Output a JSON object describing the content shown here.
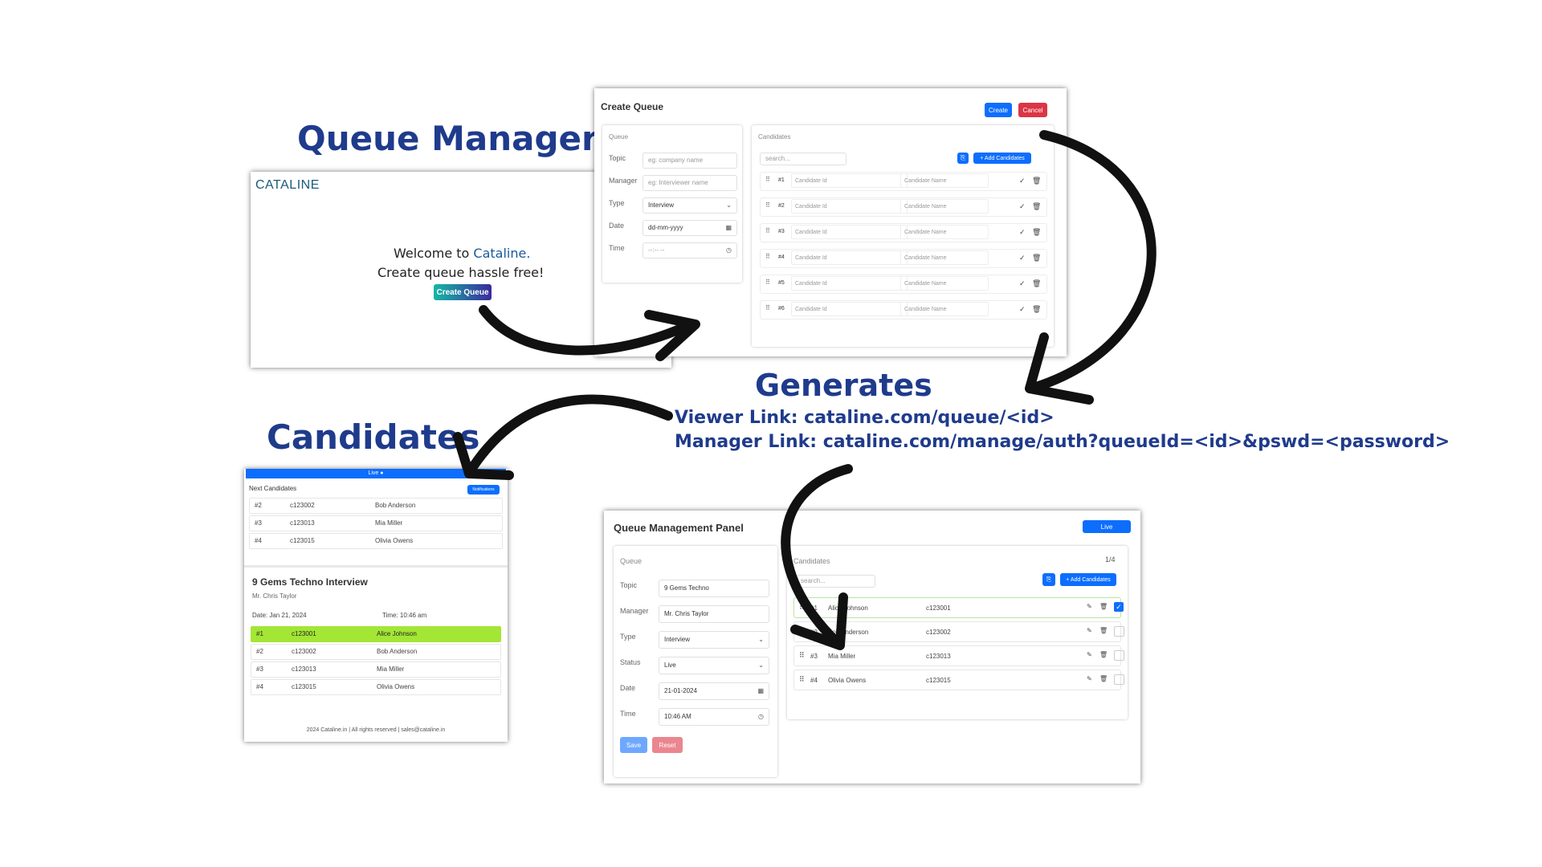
{
  "headings": {
    "queue_manager": "Queue Manager",
    "candidates": "Candidates",
    "generates": "Generates"
  },
  "links": {
    "viewer": "Viewer Link:  cataline.com/queue/<id>",
    "manager": "Manager Link: cataline.com/manage/auth?queueId=<id>&pswd=<password>"
  },
  "landing": {
    "logo": "CATALINE",
    "welcome_prefix": "Welcome to ",
    "welcome_brand": "Cataline.",
    "tagline": "Create queue hassle free!",
    "create_button": "Create Queue"
  },
  "create_queue": {
    "title": "Create Queue",
    "create_button": "Create",
    "cancel_button": "Cancel",
    "queue_section": "Queue",
    "fields": {
      "topic_label": "Topic",
      "topic_placeholder": "eg: company name",
      "manager_label": "Manager",
      "manager_placeholder": "eg: Interviewer name",
      "type_label": "Type",
      "type_value": "Interview",
      "date_label": "Date",
      "date_placeholder": "dd-mm-yyyy",
      "time_label": "Time",
      "time_placeholder": "--:-- --"
    },
    "candidates_section": "Candidates",
    "search_placeholder": "search...",
    "add_candidates_button": "+ Add Candidates",
    "rows": [
      {
        "num": "#1",
        "id_placeholder": "Candidate Id",
        "name_placeholder": "Candidate Name"
      },
      {
        "num": "#2",
        "id_placeholder": "Candidate Id",
        "name_placeholder": "Candidate Name"
      },
      {
        "num": "#3",
        "id_placeholder": "Candidate Id",
        "name_placeholder": "Candidate Name"
      },
      {
        "num": "#4",
        "id_placeholder": "Candidate Id",
        "name_placeholder": "Candidate Name"
      },
      {
        "num": "#5",
        "id_placeholder": "Candidate Id",
        "name_placeholder": "Candidate Name"
      },
      {
        "num": "#6",
        "id_placeholder": "Candidate Id",
        "name_placeholder": "Candidate Name"
      }
    ]
  },
  "viewer": {
    "live_bar": "Live ●",
    "next_candidates": "Next Candidates",
    "notifications_button": "Notifications",
    "next_rows": [
      {
        "num": "#2",
        "id": "c123002",
        "name": "Bob Anderson"
      },
      {
        "num": "#3",
        "id": "c123013",
        "name": "Mia Miller"
      },
      {
        "num": "#4",
        "id": "c123015",
        "name": "Olivia Owens"
      }
    ],
    "title": "9 Gems Techno Interview",
    "manager": "Mr. Chris Taylor",
    "date": "Date: Jan 21, 2024",
    "time": "Time: 10:46 am",
    "queue_rows": [
      {
        "num": "#1",
        "id": "c123001",
        "name": "Alice Johnson",
        "current": true
      },
      {
        "num": "#2",
        "id": "c123002",
        "name": "Bob Anderson",
        "current": false
      },
      {
        "num": "#3",
        "id": "c123013",
        "name": "Mia Miller",
        "current": false
      },
      {
        "num": "#4",
        "id": "c123015",
        "name": "Olivia Owens",
        "current": false
      }
    ],
    "footer": "2024 Cataline.in | All rights reserved | sales@cataline.in"
  },
  "management": {
    "title": "Queue Management Panel",
    "live_button": "Live",
    "queue_section": "Queue",
    "fields": {
      "topic_label": "Topic",
      "topic_value": "9 Gems Techno",
      "manager_label": "Manager",
      "manager_value": "Mr. Chris Taylor",
      "type_label": "Type",
      "type_value": "Interview",
      "status_label": "Status",
      "status_value": "Live",
      "date_label": "Date",
      "date_value": "21-01-2024",
      "time_label": "Time",
      "time_value": "10:46 AM"
    },
    "save_button": "Save",
    "reset_button": "Reset",
    "candidates_section": "Candidates",
    "counter": "1/4",
    "search_placeholder": "search...",
    "add_candidates_button": "+ Add Candidates",
    "rows": [
      {
        "num": "#1",
        "name": "Alice Johnson",
        "id": "c123001",
        "checked": true
      },
      {
        "num": "#2",
        "name": "Bob Anderson",
        "id": "c123002",
        "checked": false
      },
      {
        "num": "#3",
        "name": "Mia Miller",
        "id": "c123013",
        "checked": false
      },
      {
        "num": "#4",
        "name": "Olivia Owens",
        "id": "c123015",
        "checked": false
      }
    ]
  },
  "colors": {
    "heading": "#1f3b8c",
    "primary": "#0d6efd",
    "danger": "#dc3545",
    "highlight": "#a3e635"
  }
}
